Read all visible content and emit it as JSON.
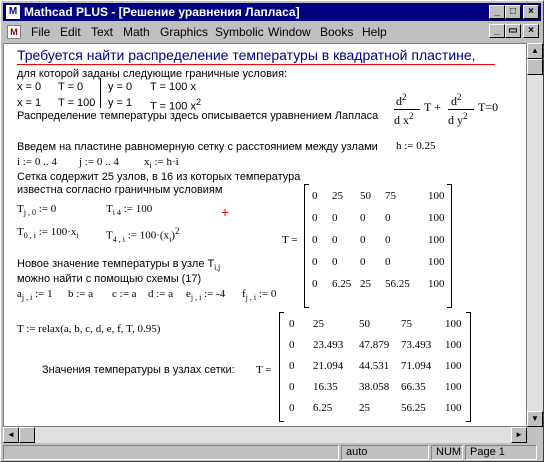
{
  "window": {
    "title": "Mathcad PLUS - [Решение уравнения Лапласа]",
    "app_icon": "M",
    "buttons": {
      "minimize": "_",
      "maximize": "□",
      "close": "×"
    }
  },
  "menu": {
    "doc_icon": "M",
    "items": [
      "File",
      "Edit",
      "Text",
      "Math",
      "Graphics",
      "Symbolic",
      "Window",
      "Books",
      "Help"
    ],
    "buttons": {
      "minimize": "_",
      "restore": "▭",
      "close": "×"
    }
  },
  "document": {
    "heading": "Требуется найти  распределение температуры в квадратной пластине,",
    "line1": "для которой заданы следующие граничные условия:",
    "bc": {
      "r1c1": "x = 0",
      "r1c2": "T = 0",
      "r1c3": "y = 0",
      "r1c4": "T = 100 x",
      "r2c1": "x = 1",
      "r2c2": "T = 100",
      "r2c3": "y = 1",
      "r2c4": "T = 100 x",
      "r2c4sup": "2"
    },
    "laplace_text": "Распределение температуры здесь описывается уравнением Лапласа",
    "laplace": {
      "d1": "d",
      "d1sup": "2",
      "den1": "d x",
      "den1sup": "2",
      "T1": "T +",
      "d2": "d",
      "d2sup": "2",
      "den2": "d y",
      "den2sup": "2",
      "tail": "T=0"
    },
    "grid_text": "Введем на пластине равномерную сетку с расстоянием между узлами",
    "h_def": "h := 0.25",
    "range_i": "i := 0 .. 4",
    "range_j": "j := 0 .. 4",
    "x_def": "x",
    "x_sub": "i",
    "x_def2": " := h·i",
    "nodes_text1": "Сетка содержит 25 узлов, в 16 из которых температура",
    "nodes_text2": "известна согласно граничным условиям",
    "bc_defs": {
      "a1": "T",
      "a1sub": "j , 0",
      "a1rhs": " := 0",
      "a2": "T",
      "a2sub": "i 4",
      "a2rhs": " := 100",
      "a3": "T",
      "a3sub": "0 , i",
      "a3rhs": " := 100·x",
      "a3rhssub": "i",
      "a4": "T",
      "a4sub": "4 , i",
      "a4rhs": " := 100·(x",
      "a4rhssub": "i",
      "a4rhs2": ")",
      "a4sup": "2"
    },
    "new_val_text1": "Новое значение температуры в узле T",
    "new_val_sub": "i,j",
    "new_val_text2": "можно найти с помощью схемы (17)",
    "coefs": [
      {
        "name": "a",
        "sub": "j , i",
        "rhs": " := 1"
      },
      {
        "name": "b",
        "sub": "",
        "rhs": " := a"
      },
      {
        "name": "c",
        "sub": "",
        "rhs": " := a"
      },
      {
        "name": "d",
        "sub": "",
        "rhs": " := a"
      },
      {
        "name": "e",
        "sub": "j , i",
        "rhs": " := -4"
      },
      {
        "name": "f",
        "sub": "j , i",
        "rhs": " := 0"
      }
    ],
    "relax_def": "T := relax(a, b, c, d, e, f, T, 0.95)",
    "result_text": "Значения температуры  в узлах сетки:",
    "matrix1_label": "T =",
    "matrix1": [
      [
        "0",
        "25",
        "50",
        "75",
        "100"
      ],
      [
        "0",
        "0",
        "0",
        "0",
        "100"
      ],
      [
        "0",
        "0",
        "0",
        "0",
        "100"
      ],
      [
        "0",
        "0",
        "0",
        "0",
        "100"
      ],
      [
        "0",
        "6.25",
        "25",
        "56.25",
        "100"
      ]
    ],
    "matrix2_label": "T =",
    "matrix2": [
      [
        "0",
        "25",
        "50",
        "75",
        "100"
      ],
      [
        "0",
        "23.493",
        "47.879",
        "73.493",
        "100"
      ],
      [
        "0",
        "21.094",
        "44.531",
        "71.094",
        "100"
      ],
      [
        "0",
        "16.35",
        "38.058",
        "66.35",
        "100"
      ],
      [
        "0",
        "6.25",
        "25",
        "56.25",
        "100"
      ]
    ]
  },
  "scrollbars": {
    "up": "▲",
    "down": "▼",
    "left": "◄",
    "right": "►"
  },
  "status": {
    "mode": "auto",
    "num": "NUM",
    "page": "Page 1"
  }
}
